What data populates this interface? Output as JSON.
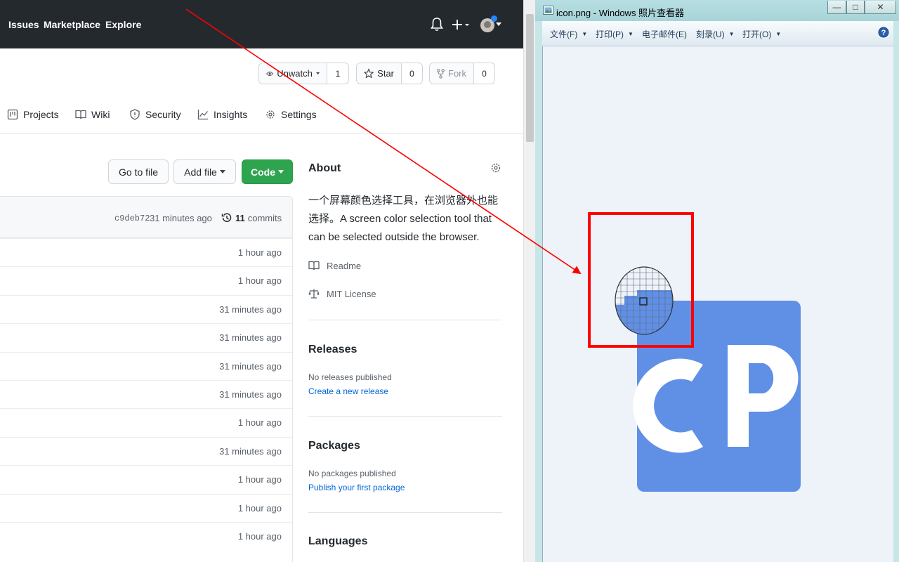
{
  "github": {
    "header": {
      "links": [
        "Issues",
        "Marketplace",
        "Explore"
      ]
    },
    "repo_actions": {
      "unwatch_label": "Unwatch",
      "unwatch_count": "1",
      "star_label": "Star",
      "star_count": "0",
      "fork_label": "Fork",
      "fork_count": "0"
    },
    "tabs": [
      "Projects",
      "Wiki",
      "Security",
      "Insights",
      "Settings"
    ],
    "file_actions": {
      "go_to_file": "Go to file",
      "add_file": "Add file",
      "code": "Code"
    },
    "latest_commit": {
      "sha": "c9deb72",
      "time": "31 minutes ago",
      "commits_count": "11",
      "commits_label": "commits"
    },
    "file_row_times": [
      "1 hour ago",
      "1 hour ago",
      "31 minutes ago",
      "31 minutes ago",
      "31 minutes ago",
      "31 minutes ago",
      "1 hour ago",
      "31 minutes ago",
      "1 hour ago",
      "1 hour ago",
      "1 hour ago"
    ],
    "about": {
      "title": "About",
      "description_line1": "一个屏幕颜色选择工具，在浏览器外也能",
      "description_line2": "选择。A screen color selection tool that",
      "description_line3": "can be selected outside the browser.",
      "readme": "Readme",
      "license": "MIT License"
    },
    "releases": {
      "title": "Releases",
      "empty": "No releases published",
      "link": "Create a new release"
    },
    "packages": {
      "title": "Packages",
      "empty": "No packages published",
      "link": "Publish your first package"
    },
    "languages": {
      "title": "Languages"
    }
  },
  "viewer": {
    "title": "icon.png - Windows 照片查看器",
    "controls": [
      "—",
      "□",
      "✕"
    ],
    "menu": [
      "文件(F)",
      "打印(P)",
      "电子邮件(E)",
      "刻录(U)",
      "打开(O)"
    ],
    "image_text": "CP"
  },
  "colors": {
    "header_bg": "#24292e",
    "primary_green": "#2ea44f",
    "link_blue": "#0366d6",
    "cp_blue": "#6090e6",
    "annotation_red": "#ff0000"
  }
}
